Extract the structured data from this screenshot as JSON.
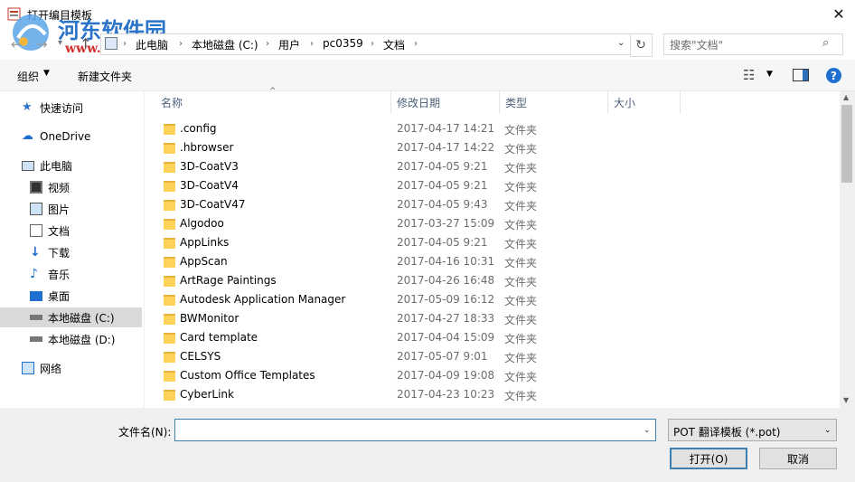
{
  "window": {
    "title": "打开编目模板",
    "close_glyph": "✕"
  },
  "watermark": {
    "text": "河东软件园",
    "url": "www.pc0359.cn"
  },
  "address": {
    "breadcrumbs": [
      "此电脑",
      "本地磁盘 (C:)",
      "用户",
      "pc0359",
      "文档"
    ],
    "search_placeholder": "搜索\"文档\""
  },
  "toolbar": {
    "organize": "组织",
    "new_folder": "新建文件夹",
    "help": "?"
  },
  "nav": {
    "items": [
      {
        "label": "快速访问",
        "icon": "star-icon"
      },
      {
        "label": "OneDrive",
        "icon": "cloud-icon"
      },
      {
        "label": "此电脑",
        "icon": "pc-icon"
      },
      {
        "label": "视频",
        "icon": "video-icon"
      },
      {
        "label": "图片",
        "icon": "picture-icon"
      },
      {
        "label": "文档",
        "icon": "document-icon"
      },
      {
        "label": "下载",
        "icon": "download-icon"
      },
      {
        "label": "音乐",
        "icon": "music-icon"
      },
      {
        "label": "桌面",
        "icon": "desktop-icon"
      },
      {
        "label": "本地磁盘 (C:)",
        "icon": "drive-icon",
        "selected": true
      },
      {
        "label": "本地磁盘 (D:)",
        "icon": "drive-icon"
      },
      {
        "label": "网络",
        "icon": "network-icon"
      }
    ]
  },
  "columns": [
    "名称",
    "修改日期",
    "类型",
    "大小"
  ],
  "files": [
    {
      "name": ".config",
      "date": "2017-04-17 14:21",
      "type": "文件夹"
    },
    {
      "name": ".hbrowser",
      "date": "2017-04-17 14:22",
      "type": "文件夹"
    },
    {
      "name": "3D-CoatV3",
      "date": "2017-04-05 9:21",
      "type": "文件夹"
    },
    {
      "name": "3D-CoatV4",
      "date": "2017-04-05 9:21",
      "type": "文件夹"
    },
    {
      "name": "3D-CoatV47",
      "date": "2017-04-05 9:43",
      "type": "文件夹"
    },
    {
      "name": "Algodoo",
      "date": "2017-03-27 15:09",
      "type": "文件夹"
    },
    {
      "name": "AppLinks",
      "date": "2017-04-05 9:21",
      "type": "文件夹"
    },
    {
      "name": "AppScan",
      "date": "2017-04-16 10:31",
      "type": "文件夹"
    },
    {
      "name": "ArtRage Paintings",
      "date": "2017-04-26 16:48",
      "type": "文件夹"
    },
    {
      "name": "Autodesk Application Manager",
      "date": "2017-05-09 16:12",
      "type": "文件夹"
    },
    {
      "name": "BWMonitor",
      "date": "2017-04-27 18:33",
      "type": "文件夹"
    },
    {
      "name": "Card template",
      "date": "2017-04-04 15:09",
      "type": "文件夹"
    },
    {
      "name": "CELSYS",
      "date": "2017-05-07 9:01",
      "type": "文件夹"
    },
    {
      "name": "Custom Office Templates",
      "date": "2017-04-09 19:08",
      "type": "文件夹"
    },
    {
      "name": "CyberLink",
      "date": "2017-04-23 10:23",
      "type": "文件夹"
    }
  ],
  "footer": {
    "filename_label": "文件名(N):",
    "filename_value": "",
    "filetype": "POT 翻译模板 (*.pot)",
    "open": "打开(O)",
    "cancel": "取消"
  }
}
